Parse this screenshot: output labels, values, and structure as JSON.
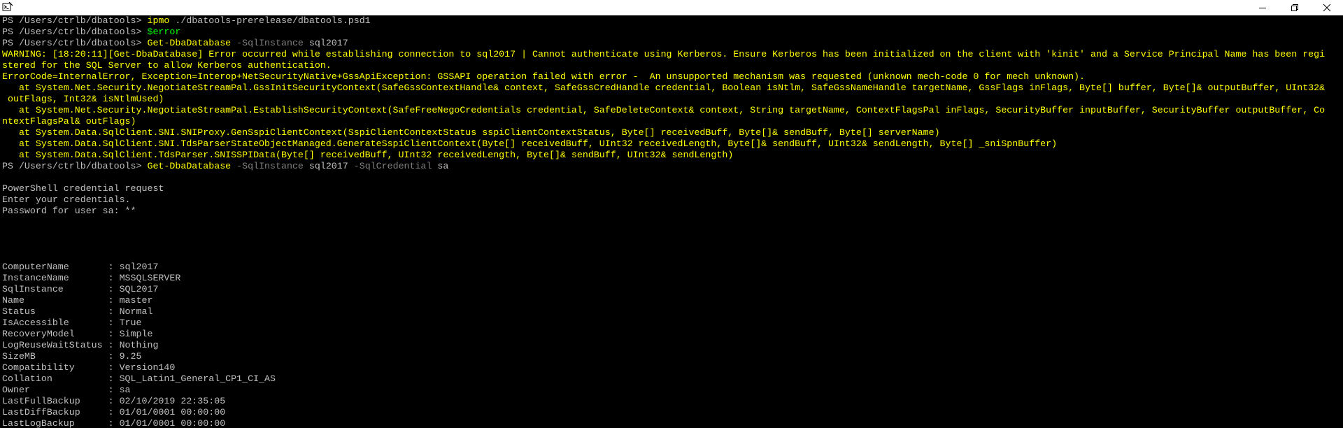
{
  "window": {
    "icon": "powershell-icon",
    "controls": {
      "minimize": "minimize-icon",
      "maximize": "restore-icon",
      "close": "close-icon"
    }
  },
  "colors": {
    "background": "#000000",
    "default_text": "#c0c0c0",
    "command": "#ffff00",
    "parameter": "#808080",
    "variable": "#00ff00",
    "warning": "#ffff00",
    "error": "#ffff00"
  },
  "lines": [
    {
      "segments": [
        {
          "text": "PS /Users/ctrlb/dbatools> ",
          "style": "default"
        },
        {
          "text": "ipmo",
          "style": "cmd"
        },
        {
          "text": " ./dbatools-prerelease/dbatools.psd1",
          "style": "default"
        }
      ]
    },
    {
      "segments": [
        {
          "text": "PS /Users/ctrlb/dbatools> ",
          "style": "default"
        },
        {
          "text": "$error",
          "style": "var"
        }
      ]
    },
    {
      "segments": [
        {
          "text": "PS /Users/ctrlb/dbatools> ",
          "style": "default"
        },
        {
          "text": "Get-DbaDatabase",
          "style": "cmd"
        },
        {
          "text": " -SqlInstance",
          "style": "param"
        },
        {
          "text": " sql2017",
          "style": "default"
        }
      ]
    },
    {
      "segments": [
        {
          "text": "WARNING: [18:20:11][Get-DbaDatabase] Error occurred while establishing connection to sql2017 | Cannot authenticate using Kerberos. Ensure Kerberos has been initialized on the client with 'kinit' and a Service Principal Name has been regi",
          "style": "warn"
        }
      ]
    },
    {
      "segments": [
        {
          "text": "stered for the SQL Server to allow Kerberos authentication.",
          "style": "warn"
        }
      ]
    },
    {
      "segments": [
        {
          "text": "ErrorCode=InternalError, Exception=Interop+NetSecurityNative+GssApiException: GSSAPI operation failed with error -  An unsupported mechanism was requested (unknown mech-code 0 for mech unknown).",
          "style": "err"
        }
      ]
    },
    {
      "segments": [
        {
          "text": "   at System.Net.Security.NegotiateStreamPal.GssInitSecurityContext(SafeGssContextHandle& context, SafeGssCredHandle credential, Boolean isNtlm, SafeGssNameHandle targetName, GssFlags inFlags, Byte[] buffer, Byte[]& outputBuffer, UInt32&",
          "style": "err"
        }
      ]
    },
    {
      "segments": [
        {
          "text": " outFlags, Int32& isNtlmUsed)",
          "style": "err"
        }
      ]
    },
    {
      "segments": [
        {
          "text": "   at System.Net.Security.NegotiateStreamPal.EstablishSecurityContext(SafeFreeNegoCredentials credential, SafeDeleteContext& context, String targetName, ContextFlagsPal inFlags, SecurityBuffer inputBuffer, SecurityBuffer outputBuffer, Co",
          "style": "err"
        }
      ]
    },
    {
      "segments": [
        {
          "text": "ntextFlagsPal& outFlags)",
          "style": "err"
        }
      ]
    },
    {
      "segments": [
        {
          "text": "   at System.Data.SqlClient.SNI.SNIProxy.GenSspiClientContext(SspiClientContextStatus sspiClientContextStatus, Byte[] receivedBuff, Byte[]& sendBuff, Byte[] serverName)",
          "style": "err"
        }
      ]
    },
    {
      "segments": [
        {
          "text": "   at System.Data.SqlClient.SNI.TdsParserStateObjectManaged.GenerateSspiClientContext(Byte[] receivedBuff, UInt32 receivedLength, Byte[]& sendBuff, UInt32& sendLength, Byte[] _sniSpnBuffer)",
          "style": "err"
        }
      ]
    },
    {
      "segments": [
        {
          "text": "   at System.Data.SqlClient.TdsParser.SNISSPIData(Byte[] receivedBuff, UInt32 receivedLength, Byte[]& sendBuff, UInt32& sendLength)",
          "style": "err"
        }
      ]
    },
    {
      "segments": [
        {
          "text": "PS /Users/ctrlb/dbatools> ",
          "style": "default"
        },
        {
          "text": "Get-DbaDatabase",
          "style": "cmd"
        },
        {
          "text": " -SqlInstance",
          "style": "param"
        },
        {
          "text": " sql2017",
          "style": "default"
        },
        {
          "text": " -SqlCredential",
          "style": "param"
        },
        {
          "text": " sa",
          "style": "default"
        }
      ]
    },
    {
      "segments": [
        {
          "text": "",
          "style": "default"
        }
      ]
    },
    {
      "segments": [
        {
          "text": "PowerShell credential request",
          "style": "default"
        }
      ]
    },
    {
      "segments": [
        {
          "text": "Enter your credentials.",
          "style": "default"
        }
      ]
    },
    {
      "segments": [
        {
          "text": "Password for user sa: **",
          "style": "default"
        }
      ]
    },
    {
      "segments": [
        {
          "text": "",
          "style": "default"
        }
      ]
    },
    {
      "segments": [
        {
          "text": "",
          "style": "default"
        }
      ]
    },
    {
      "segments": [
        {
          "text": "",
          "style": "default"
        }
      ]
    },
    {
      "segments": [
        {
          "text": "",
          "style": "default"
        }
      ]
    },
    {
      "segments": [
        {
          "text": "ComputerName       : sql2017",
          "style": "default"
        }
      ]
    },
    {
      "segments": [
        {
          "text": "InstanceName       : MSSQLSERVER",
          "style": "default"
        }
      ]
    },
    {
      "segments": [
        {
          "text": "SqlInstance        : SQL2017",
          "style": "default"
        }
      ]
    },
    {
      "segments": [
        {
          "text": "Name               : master",
          "style": "default"
        }
      ]
    },
    {
      "segments": [
        {
          "text": "Status             : Normal",
          "style": "default"
        }
      ]
    },
    {
      "segments": [
        {
          "text": "IsAccessible       : True",
          "style": "default"
        }
      ]
    },
    {
      "segments": [
        {
          "text": "RecoveryModel      : Simple",
          "style": "default"
        }
      ]
    },
    {
      "segments": [
        {
          "text": "LogReuseWaitStatus : Nothing",
          "style": "default"
        }
      ]
    },
    {
      "segments": [
        {
          "text": "SizeMB             : 9.25",
          "style": "default"
        }
      ]
    },
    {
      "segments": [
        {
          "text": "Compatibility      : Version140",
          "style": "default"
        }
      ]
    },
    {
      "segments": [
        {
          "text": "Collation          : SQL_Latin1_General_CP1_CI_AS",
          "style": "default"
        }
      ]
    },
    {
      "segments": [
        {
          "text": "Owner              : sa",
          "style": "default"
        }
      ]
    },
    {
      "segments": [
        {
          "text": "LastFullBackup     : 02/10/2019 22:35:05",
          "style": "default"
        }
      ]
    },
    {
      "segments": [
        {
          "text": "LastDiffBackup     : 01/01/0001 00:00:00",
          "style": "default"
        }
      ]
    },
    {
      "segments": [
        {
          "text": "LastLogBackup      : 01/01/0001 00:00:00",
          "style": "default"
        }
      ]
    }
  ]
}
